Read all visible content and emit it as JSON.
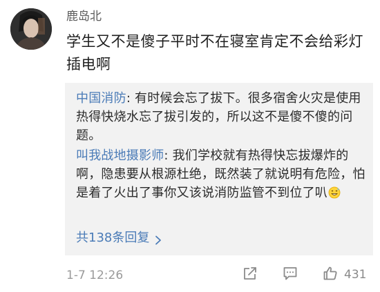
{
  "comment": {
    "username": "鹿岛北",
    "text": "学生又不是傻子平时不在寝室肯定不会给彩灯插电啊",
    "timestamp": "1-7 12:26",
    "like_count": "431"
  },
  "replies": [
    {
      "author": "中国消防",
      "separator": ": ",
      "text": "有时候会忘了拔下。很多宿舍火灾是使用热得快烧水忘了拔引发的，所以这不是傻不傻的问题。"
    },
    {
      "author": "叫我战地摄影师",
      "separator": ": ",
      "text": "我们学校就有热得快忘拔爆炸的啊，隐患要从根源杜绝，既然装了就说明有危险，怕是着了火出了事你又该说消防监管不到位了叭",
      "emoji": "grinning-sweat-emoji"
    }
  ],
  "more_replies": {
    "label": "共138条回复",
    "icon": "chevron-right-icon"
  },
  "actions": {
    "share_icon": "share-icon",
    "comment_icon": "comment-icon",
    "like_icon": "like-icon"
  },
  "colors": {
    "link": "#4a7bb7",
    "reply_background": "#f2f2f2",
    "muted": "#9a9a9a"
  }
}
